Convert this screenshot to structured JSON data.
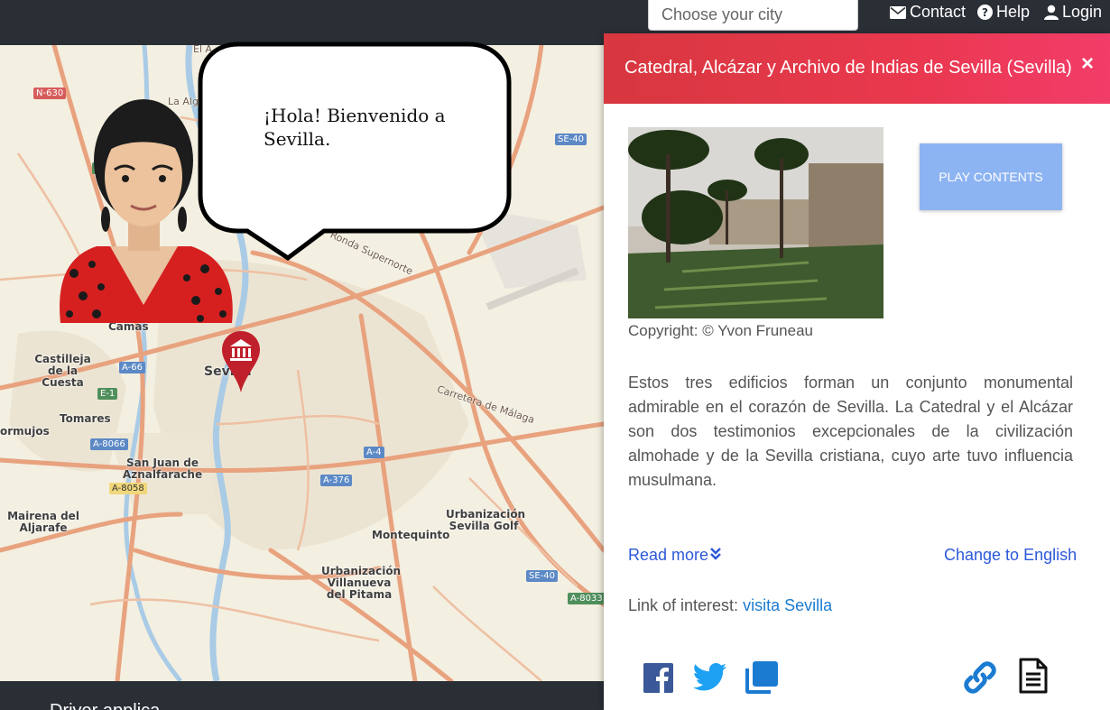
{
  "search": {
    "placeholder": "Choose your city"
  },
  "nav": {
    "contact": "Contact",
    "help": "Help",
    "login": "Login"
  },
  "bubble": {
    "text": "¡Hola! Bienvenido a Sevilla."
  },
  "map": {
    "labels": {
      "camas": "Camas",
      "castilleja": "Castilleja de la Cuesta",
      "sevilla": "Sevilla",
      "tomares": "Tomares",
      "bormujos": "ormujos",
      "san_juan": "San Juan de Aznalfarache",
      "mairena": "Mairena del Aljarafe",
      "montequinto": "Montequinto",
      "urb_golf": "Urbanización Sevilla Golf",
      "urb_villanueva": "Urbanización Villanueva del Pitama",
      "ronda": "Ronda Supernorte",
      "carretera_malaga": "Carretera de Málaga",
      "el_a": "El A",
      "la_alg": "La Alg"
    },
    "shields": {
      "n630": "N-630",
      "se40_top": "SE-40",
      "a66": "A-66",
      "e1": "E-1",
      "a8066": "A-8066",
      "a8058": "A-8058",
      "a4": "A-4",
      "a376": "A-376",
      "se40_bottom": "SE-40",
      "a8033": "A-8033",
      "e_small": "E"
    }
  },
  "panel": {
    "title": "Catedral, Alcázar y Archivo de Indias de Sevilla (Sevilla)",
    "close": "×",
    "copyright": "Copyright: © Yvon Fruneau",
    "play_label": "PLAY CONTENTS",
    "description": "Estos tres edificios forman un conjunto monumental admirable en el corazón de Sevilla. La Catedral y el Alcázar son dos testimonios excepcionales de la civilización almohade y de la Sevilla cristiana, cuyo arte tuvo influencia musulmana.",
    "read_more": "Read more",
    "change_language": "Change to English",
    "link_prefix": "Link of interest:",
    "link_text": "visita Sevilla"
  },
  "footer": {
    "text": "Driver applica..."
  },
  "colors": {
    "header_gradient_start": "#d7373f",
    "header_gradient_end": "#f23c69",
    "play_button": "#8db4f2",
    "link": "#2d59d9",
    "nav_bg": "#2a2f36",
    "map_bg": "#f3efe1",
    "pin": "#c0202b"
  },
  "icons": [
    "envelope-icon",
    "question-icon",
    "user-icon",
    "close-icon",
    "chevron-double-down-icon",
    "facebook-icon",
    "twitter-icon",
    "copy-icon",
    "link-icon",
    "document-icon",
    "museum-pin-icon"
  ]
}
